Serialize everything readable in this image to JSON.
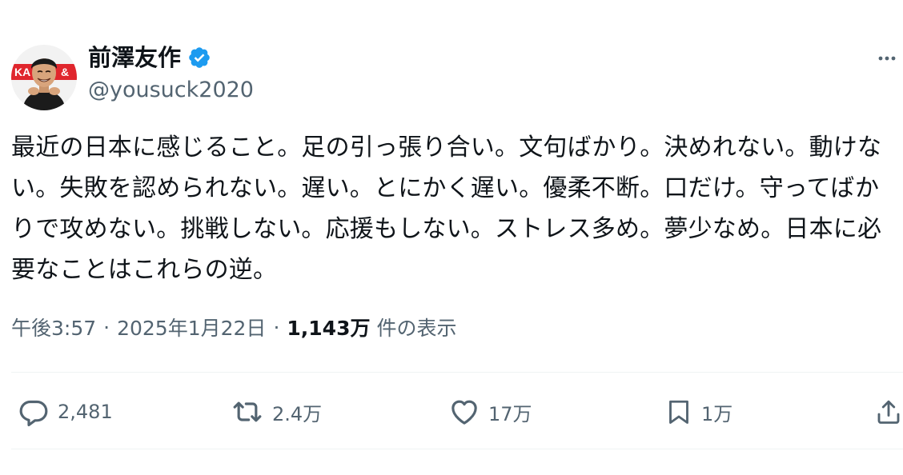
{
  "author": {
    "display_name": "前澤友作",
    "handle": "@yousuck2020",
    "verified": true,
    "verified_color": "#1d9bf0",
    "avatar_badge_text": "KA..."
  },
  "tweet": {
    "text": "最近の日本に感じること。足の引っ張り合い。文句ばかり。決めれない。動けない。失敗を認められない。遅い。とにかく遅い。優柔不断。口だけ。守ってばかりで攻めない。挑戦しない。応援もしない。ストレス多め。夢少なめ。日本に必要なことはこれらの逆。"
  },
  "meta": {
    "time": "午後3:57",
    "separator": "·",
    "date": "2025年1月22日",
    "views_count": "1,143万",
    "views_label": "件の表示"
  },
  "actions": {
    "reply": {
      "icon": "reply-icon",
      "count": "2,481"
    },
    "retweet": {
      "icon": "retweet-icon",
      "count": "2.4万"
    },
    "like": {
      "icon": "heart-icon",
      "count": "17万"
    },
    "bookmark": {
      "icon": "bookmark-icon",
      "count": "1万"
    },
    "share": {
      "icon": "share-icon"
    }
  },
  "colors": {
    "text_primary": "#0f1419",
    "text_secondary": "#536471",
    "divider": "#eff3f4",
    "avatar_badge": "#e0262d"
  }
}
